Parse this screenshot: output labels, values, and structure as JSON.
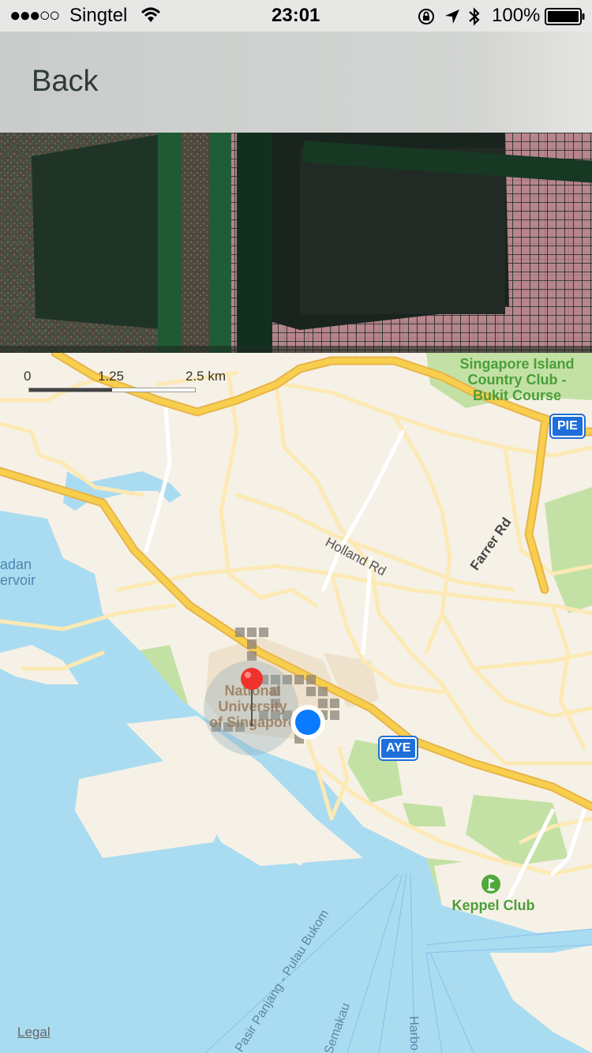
{
  "status_bar": {
    "signal": "●●●○○",
    "carrier": "Singtel",
    "time": "23:01",
    "battery": "100%",
    "icons": [
      "wifi-icon",
      "orientation-lock-icon",
      "location-arrow-icon",
      "bluetooth-icon",
      "battery-icon"
    ]
  },
  "nav": {
    "back_label": "Back"
  },
  "map": {
    "scale": {
      "labels": [
        "0",
        "1.25",
        "2.5 km"
      ]
    },
    "places": {
      "country_club": [
        "Singapore Island",
        "Country Club -",
        "Bukit Course"
      ],
      "nus": [
        "National",
        "University",
        "of Singapore"
      ],
      "keppel_club": "Keppel Club",
      "reservoir": [
        "adan",
        "ervoir"
      ]
    },
    "roads": {
      "holland": "Holland Rd",
      "farrer": "Farrer Rd",
      "pulau_bukom": "Pasir Panjang - Pulau Bukom",
      "semakau": "Semakau",
      "harbour": "Harbo"
    },
    "shields": {
      "pie": "PIE",
      "aye": "AYE"
    },
    "legal": "Legal",
    "colors": {
      "land": "#f6f1e6",
      "water": "#aadcf1",
      "park": "#c3e1a4",
      "highway": "#f7cf4d",
      "road": "#fde9b4",
      "user_dot": "#0a7aff",
      "pin": "#f0322d"
    }
  }
}
